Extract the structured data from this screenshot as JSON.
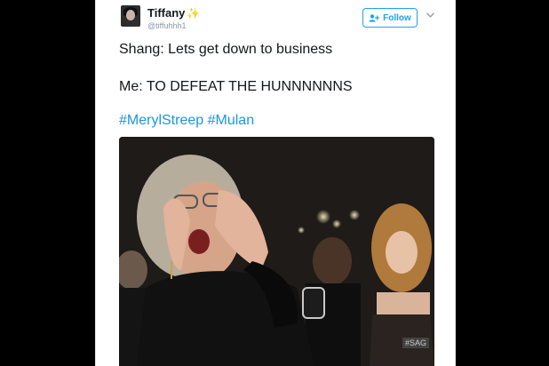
{
  "tweet": {
    "author_name": "Tiffany",
    "author_handle": "@tiffuhhh1",
    "name_emoji": "✨",
    "follow_label": "Follow",
    "line1": "Shang: Lets get down to business",
    "line2": "Me: TO DEFEAT THE HUNNNNNNS",
    "hashtags": [
      "#MerylStreep",
      "#Mulan"
    ]
  },
  "media": {
    "watermark": "#SAG"
  },
  "icons": {
    "follow": "add-user-icon",
    "more": "chevron-down-icon"
  },
  "colors": {
    "accent": "#1da1f2",
    "hashtag": "#1b95e0",
    "backdrop": "#000000",
    "text": "#14171a",
    "secondary": "#8899a6"
  }
}
